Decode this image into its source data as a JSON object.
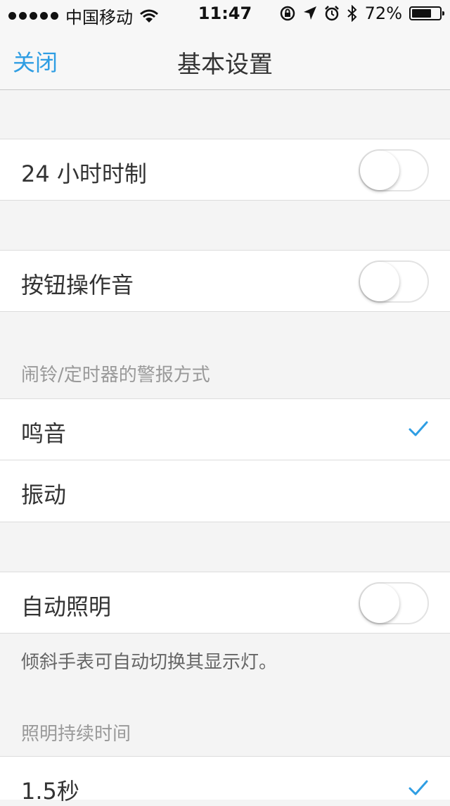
{
  "status_bar": {
    "carrier": "中国移动",
    "time": "11:47",
    "battery": "72%",
    "battery_level": 0.72,
    "icons": [
      "signal-dots-icon",
      "wifi-icon",
      "rotation-lock-icon",
      "location-icon",
      "alarm-icon",
      "bluetooth-icon",
      "battery-icon"
    ]
  },
  "nav": {
    "close_label": "关闭",
    "title": "基本设置"
  },
  "settings": {
    "clock24": {
      "label": "24 小时时制",
      "on": false
    },
    "button_sound": {
      "label": "按钮操作音",
      "on": false
    },
    "alert_header": "闹铃/定时器的警报方式",
    "alert_options": [
      {
        "label": "鸣音",
        "checked": true
      },
      {
        "label": "振动",
        "checked": false
      }
    ],
    "auto_light": {
      "label": "自动照明",
      "on": false
    },
    "auto_light_note": "倾斜手表可自动切换其显示灯。",
    "duration_header": "照明持续时间",
    "duration_options": [
      {
        "label": "1.5秒",
        "checked": true
      }
    ]
  },
  "colors": {
    "accent": "#2f9ee3",
    "background": "#f4f4f4",
    "cell": "#ffffff"
  }
}
